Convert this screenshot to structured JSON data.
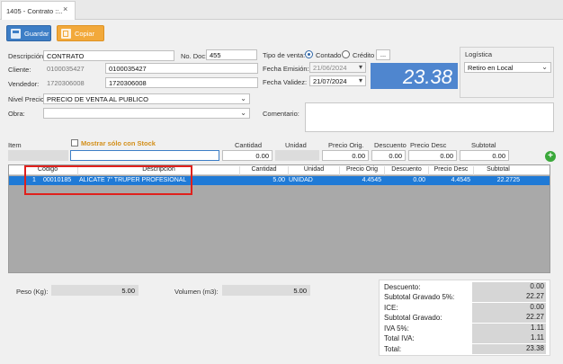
{
  "tab": {
    "title": "1405 - Contrato ::..",
    "close": "×"
  },
  "toolbar": {
    "save_label": "Guardar",
    "copy_label": "Copiar"
  },
  "form": {
    "descripcion_label": "Descripción:",
    "descripcion_value": "CONTRATO",
    "nodoc_label": "No. Doc:",
    "nodoc_value": "455",
    "cliente_label": "Cliente:",
    "cliente_id": "0100035427",
    "cliente_name": "0100035427",
    "vendedor_label": "Vendedor:",
    "vendedor_id": "1720306008",
    "vendedor_name": "1720306008",
    "nivel_precio_label": "Nivel Precio:",
    "nivel_precio_value": "PRECIO DE VENTA AL PUBLICO",
    "obra_label": "Obra:",
    "obra_value": "",
    "tipo_venta_label": "Tipo de venta:",
    "contado_label": "Contado",
    "credito_label": "Crédito",
    "more_label": "...",
    "fecha_emision_label": "Fecha Emisión:",
    "fecha_emision_value": "21/06/2024",
    "fecha_validez_label": "Fecha Validez:",
    "fecha_validez_value": "21/07/2024",
    "total_display": "23.38",
    "logistica_label": "Logística",
    "logistica_value": "Retiro en Local",
    "comentario_label": "Comentario:"
  },
  "entry": {
    "item_label": "Item",
    "mostrar_stock_label": "Mostrar sólo con Stock",
    "cantidad_label": "Cantidad",
    "unidad_label": "Unidad",
    "precio_orig_label": "Precio Orig.",
    "descuento_label": "Descuento",
    "precio_desc_label": "Precio Desc",
    "subtotal_label": "Subtotal",
    "cantidad_value": "0.00",
    "precio_orig_value": "0.00",
    "descuento_value": "0.00",
    "precio_desc_value": "0.00",
    "subtotal_value": "0.00"
  },
  "grid": {
    "columns": [
      "Código",
      "Descripción",
      "Cantidad",
      "Unidad",
      "Precio Orig",
      "Descuento",
      "Precio Desc",
      "Subtotal"
    ],
    "rows": [
      {
        "num": "1",
        "codigo": "00010185",
        "descripcion": "ALICATE 7\" TRUPER PROFESIONAL",
        "cantidad": "5.00",
        "unidad": "UNIDAD",
        "precio_orig": "4.4545",
        "descuento": "0.00",
        "precio_desc": "4.4545",
        "subtotal": "22.2725"
      }
    ]
  },
  "footer": {
    "peso_label": "Peso (Kg):",
    "peso_value": "5.00",
    "volumen_label": "Volumen (m3):",
    "volumen_value": "5.00"
  },
  "summary": {
    "descuento_label": "Descuento:",
    "descuento_value": "0.00",
    "subtotal_gravado5_label": "Subtotal Gravado 5%:",
    "subtotal_gravado5_value": "22.27",
    "ice_label": "ICE:",
    "ice_value": "0.00",
    "subtotal_gravado_label": "Subtotal Gravado:",
    "subtotal_gravado_value": "22.27",
    "iva5_label": "IVA 5%:",
    "iva5_value": "1.11",
    "total_iva_label": "Total IVA:",
    "total_iva_value": "1.11",
    "total_label": "Total:",
    "total_value": "23.38"
  },
  "colors": {
    "accent": "#3d7ec6",
    "total_bg": "#4f86cf",
    "selection": "#1f7ad6",
    "highlight_box": "#e0201c",
    "copy_button": "#f2a93b"
  }
}
